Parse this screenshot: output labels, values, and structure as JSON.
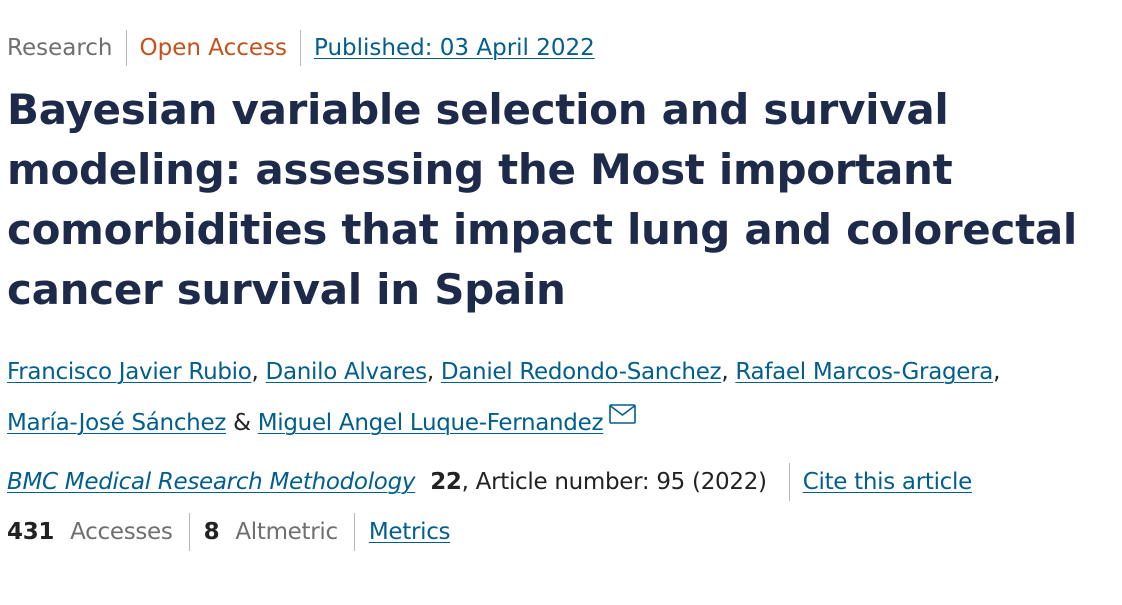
{
  "meta": {
    "type": "Research",
    "access": "Open Access",
    "published": "Published: 03 April 2022"
  },
  "title": "Bayesian variable selection and survival modeling: assessing the Most important comorbidities that impact lung and colorectal cancer survival in Spain",
  "authors": {
    "list": [
      "Francisco Javier Rubio",
      "Danilo Alvares",
      "Daniel Redondo-Sanchez",
      "Rafael Marcos-Gragera",
      "María-José Sánchez",
      "Miguel Angel Luque-Fernandez"
    ],
    "separators": [
      ", ",
      ", ",
      ", ",
      ",",
      " & "
    ],
    "corresponding_icon": "envelope-icon"
  },
  "citation": {
    "journal": "BMC Medical Research Methodology",
    "volume": "22",
    "details": ", Article number: 95 (2022)",
    "cite_label": "Cite this article"
  },
  "metrics": {
    "accesses_count": "431",
    "accesses_label": "Accesses",
    "altmetric_count": "8",
    "altmetric_label": "Altmetric",
    "metrics_link": "Metrics"
  },
  "colors": {
    "link": "#025e8d",
    "open_access": "#c4511b",
    "title": "#1e2a4a",
    "muted": "#6f6f6f"
  }
}
